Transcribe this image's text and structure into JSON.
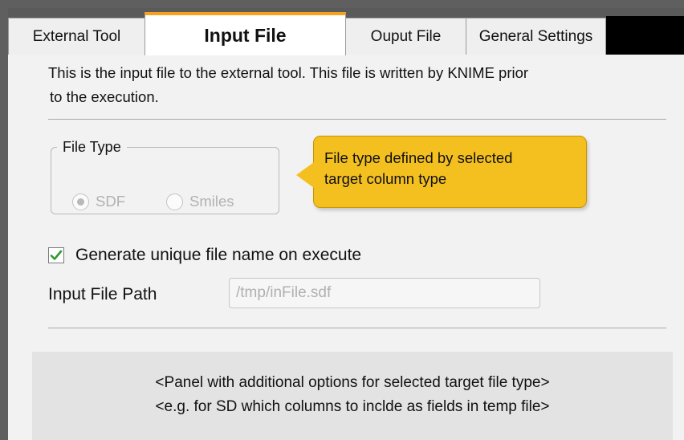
{
  "tabs": [
    {
      "label": "External Tool",
      "active": false
    },
    {
      "label": "Input File",
      "active": true
    },
    {
      "label": "Ouput File",
      "active": false
    },
    {
      "label": "General Settings",
      "active": false
    }
  ],
  "description": {
    "line1": "This is the input file to the external tool. This file is written by KNIME prior",
    "line2": "to the execution."
  },
  "file_type": {
    "legend": "File Type",
    "options": [
      {
        "label": "SDF",
        "selected": true
      },
      {
        "label": "Smiles",
        "selected": false
      }
    ]
  },
  "tooltip": {
    "line1": "File type defined by selected",
    "line2": "target column type"
  },
  "generate_unique": {
    "label": "Generate unique file name on execute",
    "checked": true
  },
  "input_path": {
    "label": "Input File Path",
    "value": "/tmp/inFile.sdf"
  },
  "options_panel": {
    "line1": "<Panel with additional options for selected target file type>",
    "line2": "<e.g. for SD which columns to inclde as fields in temp file>"
  },
  "colors": {
    "active_tab_accent": "#f5a21e",
    "tooltip_bg": "#f4c020",
    "checkmark": "#2e9a2e"
  }
}
